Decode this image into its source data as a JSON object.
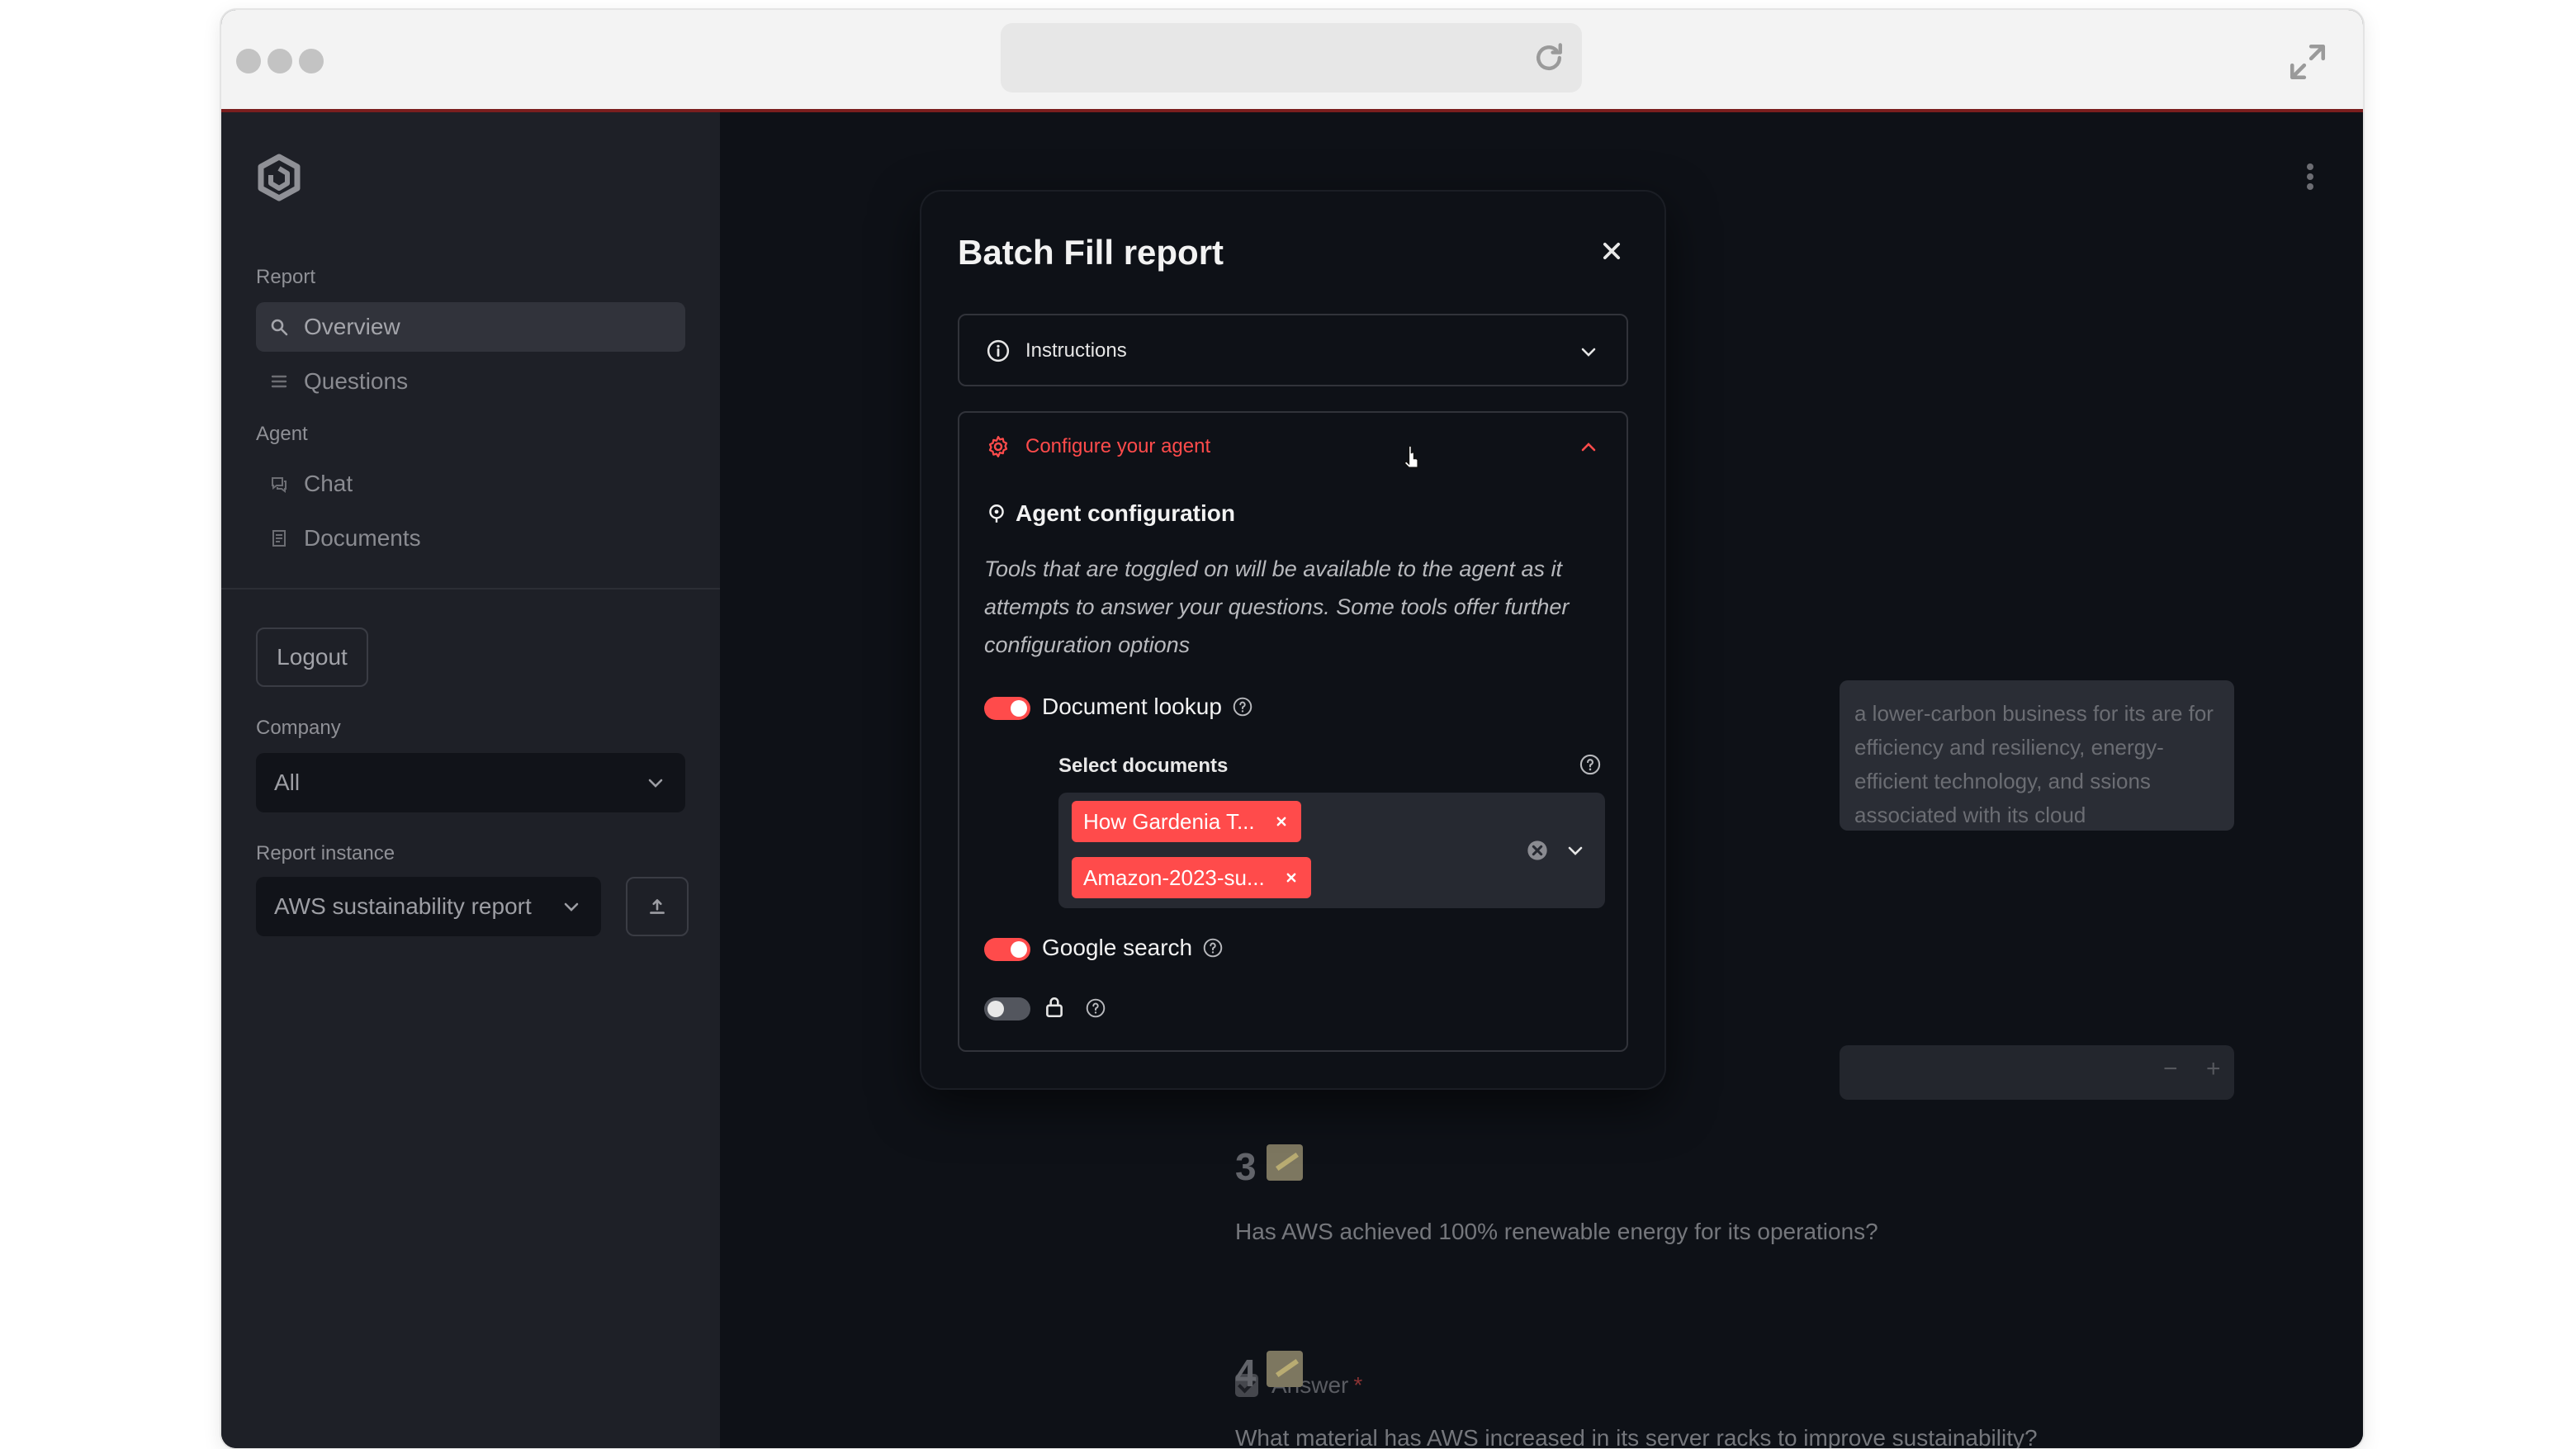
{
  "sidebar": {
    "report_section": "Report",
    "items_report": [
      {
        "label": "Overview",
        "icon": "search-icon",
        "active": true
      },
      {
        "label": "Questions",
        "icon": "list-icon",
        "active": false
      }
    ],
    "agent_section": "Agent",
    "items_agent": [
      {
        "label": "Chat",
        "icon": "chat-icon"
      },
      {
        "label": "Documents",
        "icon": "documents-icon"
      }
    ],
    "logout_label": "Logout",
    "company_label": "Company",
    "company_value": "All",
    "report_instance_label": "Report instance",
    "report_instance_value": "AWS sustainability report"
  },
  "background": {
    "answer_snippet": "a lower-carbon business for its are for efficiency and resiliency, energy-efficient technology, and ssions associated with its cloud",
    "stepper_minus": "−",
    "stepper_plus": "+",
    "questions": [
      {
        "number": "3",
        "text": "Has AWS achieved 100% renewable energy for its operations?"
      },
      {
        "number": "4",
        "text": "What material has AWS increased in its server racks to improve sustainability?"
      }
    ],
    "answer_label": "Answer",
    "answer_required_mark": "*"
  },
  "modal": {
    "title": "Batch Fill report",
    "instructions_label": "Instructions",
    "configure_label": "Configure your agent",
    "agent_config_title": "Agent configuration",
    "agent_config_desc": "Tools that are toggled on will be available to the agent as it attempts to answer your questions. Some tools offer further configuration options",
    "tools": [
      {
        "label": "Document lookup",
        "enabled": true
      },
      {
        "label": "Google search",
        "enabled": true
      },
      {
        "label": "",
        "enabled": false,
        "locked": true
      }
    ],
    "select_documents_label": "Select documents",
    "selected_documents": [
      "How Gardenia T...",
      "Amazon-2023-su..."
    ]
  },
  "colors": {
    "accent": "#ff4b4b",
    "background": "#0e1117",
    "sidebar": "#1e2027"
  }
}
